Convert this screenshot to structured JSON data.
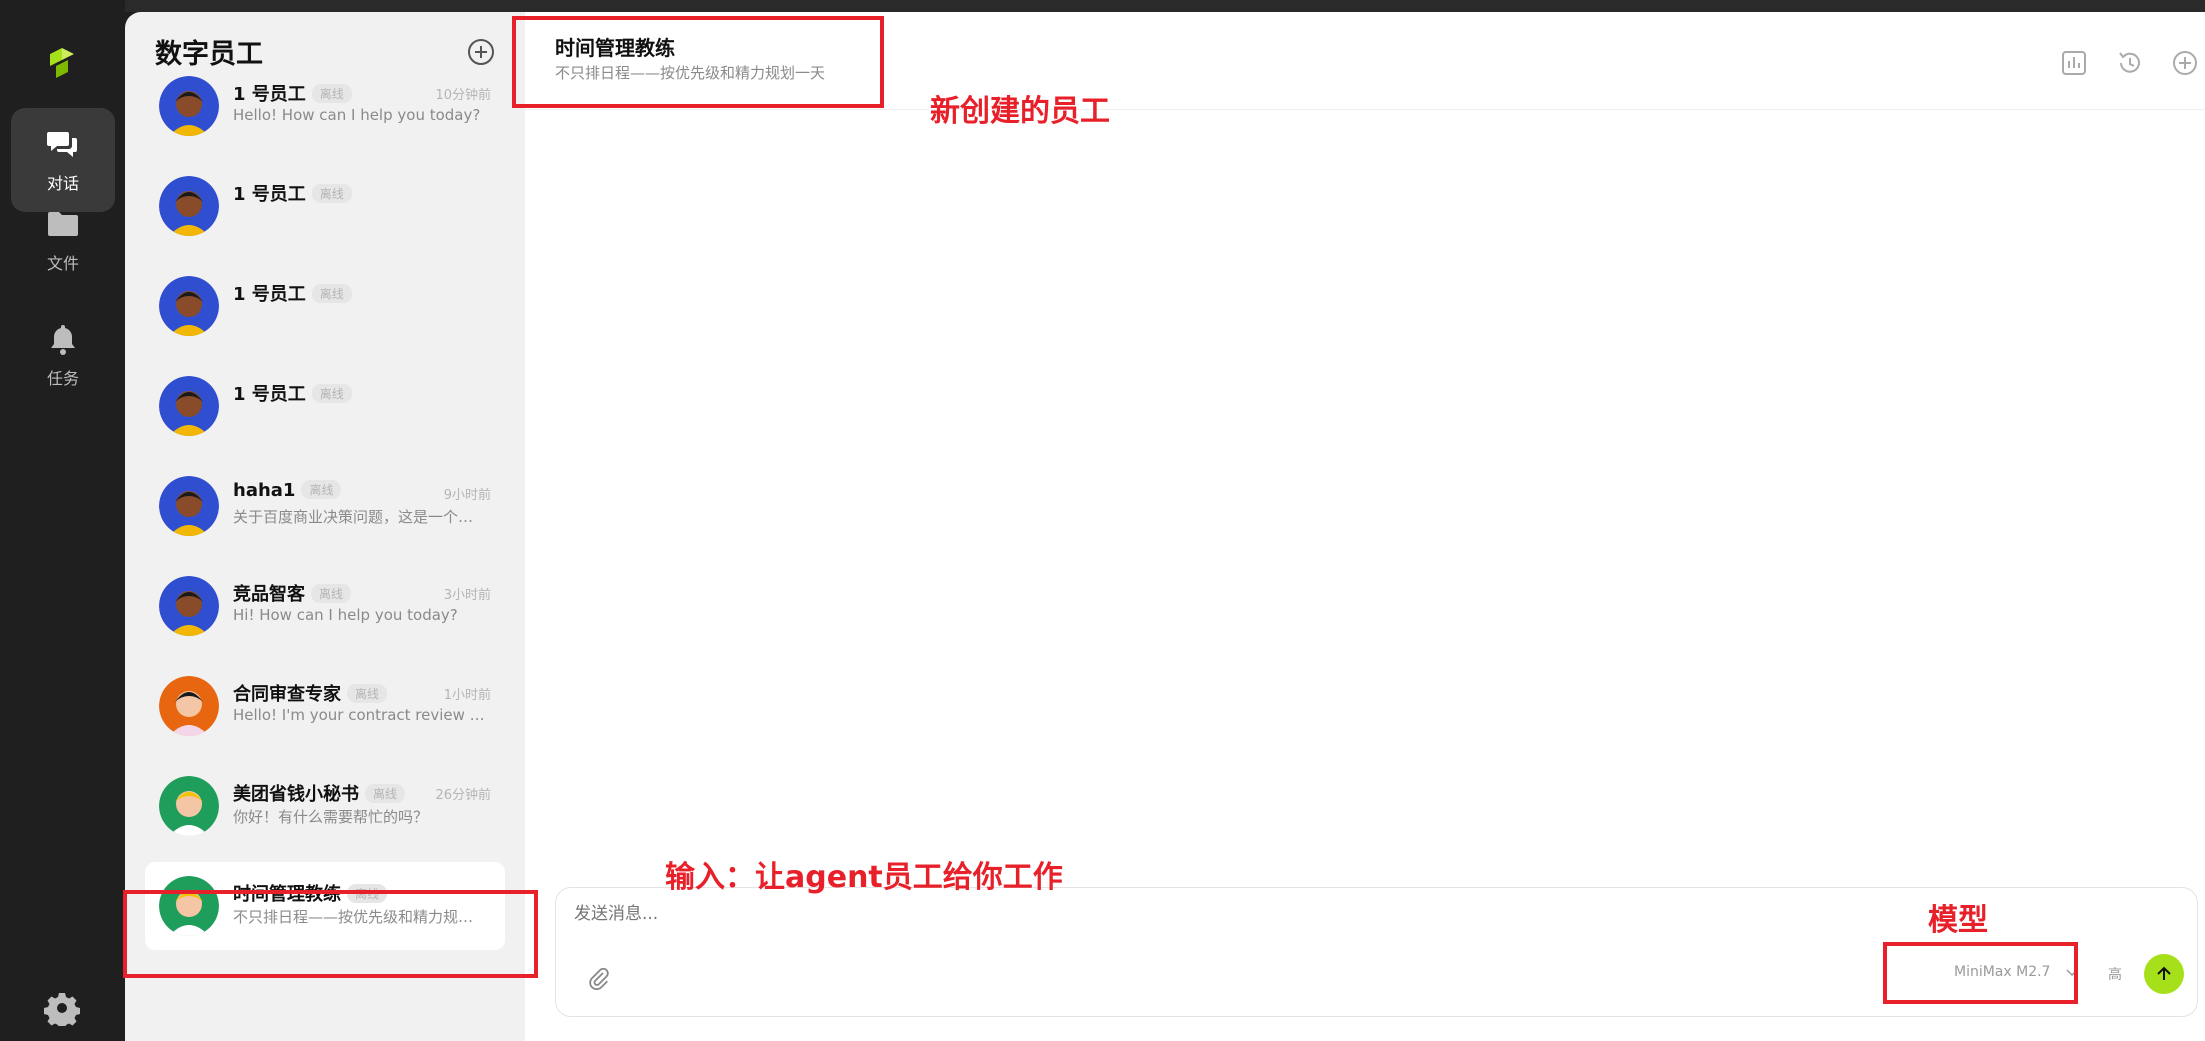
{
  "rail": {
    "items": [
      {
        "label": "对话",
        "icon": "chat-icon",
        "active": true
      },
      {
        "label": "文件",
        "icon": "folder-icon",
        "active": false
      },
      {
        "label": "任务",
        "icon": "bell-icon",
        "active": false
      }
    ],
    "settings_icon": "gear-icon"
  },
  "list": {
    "title": "数字员工",
    "add_icon": "plus-circle-icon",
    "items": [
      {
        "name": "1 号员工",
        "status": "离线",
        "time": "10分钟前",
        "message": "Hello! How can I help you today?",
        "avatar": "avatar-blue"
      },
      {
        "name": "1 号员工",
        "status": "离线",
        "time": "",
        "message": "",
        "avatar": "avatar-blue"
      },
      {
        "name": "1 号员工",
        "status": "离线",
        "time": "",
        "message": "",
        "avatar": "avatar-blue"
      },
      {
        "name": "1 号员工",
        "status": "离线",
        "time": "",
        "message": "",
        "avatar": "avatar-blue"
      },
      {
        "name": "haha1",
        "status": "离线",
        "time": "9小时前",
        "message": "关于百度商业决策问题，这是一个…",
        "avatar": "avatar-blue"
      },
      {
        "name": "竞品智客",
        "status": "离线",
        "time": "3小时前",
        "message": "Hi! How can I help you today?",
        "avatar": "avatar-blue"
      },
      {
        "name": "合同审查专家",
        "status": "离线",
        "time": "1小时前",
        "message": "Hello! I'm your contract review …",
        "avatar": "avatar-orange"
      },
      {
        "name": "美团省钱小秘书",
        "status": "离线",
        "time": "26分钟前",
        "message": "你好！有什么需要帮忙的吗？",
        "avatar": "avatar-green"
      },
      {
        "name": "时间管理教练",
        "status": "离线",
        "time": "",
        "message": "不只排日程——按优先级和精力规…",
        "avatar": "avatar-green",
        "selected": true
      }
    ]
  },
  "chat": {
    "title": "时间管理教练",
    "subtitle": "不只排日程——按优先级和精力规划一天",
    "header_icons": [
      "bar-chart-icon",
      "history-icon",
      "plus-circle-icon"
    ]
  },
  "composer": {
    "placeholder": "发送消息...",
    "model": "MiniMax M2.7",
    "mode": "高",
    "attach_icon": "paperclip-icon",
    "send_icon": "arrow-up-icon"
  },
  "annotations": {
    "new_employee": "新创建的员工",
    "input_hint": "输入：让agent员工给你工作",
    "model": "模型"
  },
  "colors": {
    "accent": "#a6e01a",
    "annotation": "#e8202a",
    "rail_bg": "#1f1f1f",
    "list_bg": "#f1f1f1"
  }
}
